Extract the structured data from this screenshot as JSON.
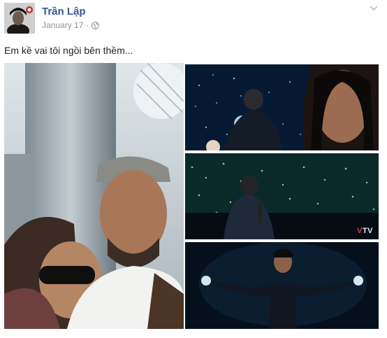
{
  "post": {
    "author": "Trần Lập",
    "date": "January 17",
    "separator": "·",
    "privacy_icon": "globe-icon",
    "menu_icon": "chevron-down-icon",
    "caption": "Em kề vai tôi ngồi bên thềm..."
  },
  "photos": {
    "main_alt": "selfie-photo",
    "thumb1_alt": "concert-singer-closeup",
    "thumb2_alt": "concert-crowd-lights",
    "thumb3_alt": "singer-arms-outstretched",
    "watermark_a": "V",
    "watermark_b": "TV"
  },
  "colors": {
    "author_link": "#365899",
    "meta_text": "#90949c",
    "body_text": "#1d2129"
  }
}
